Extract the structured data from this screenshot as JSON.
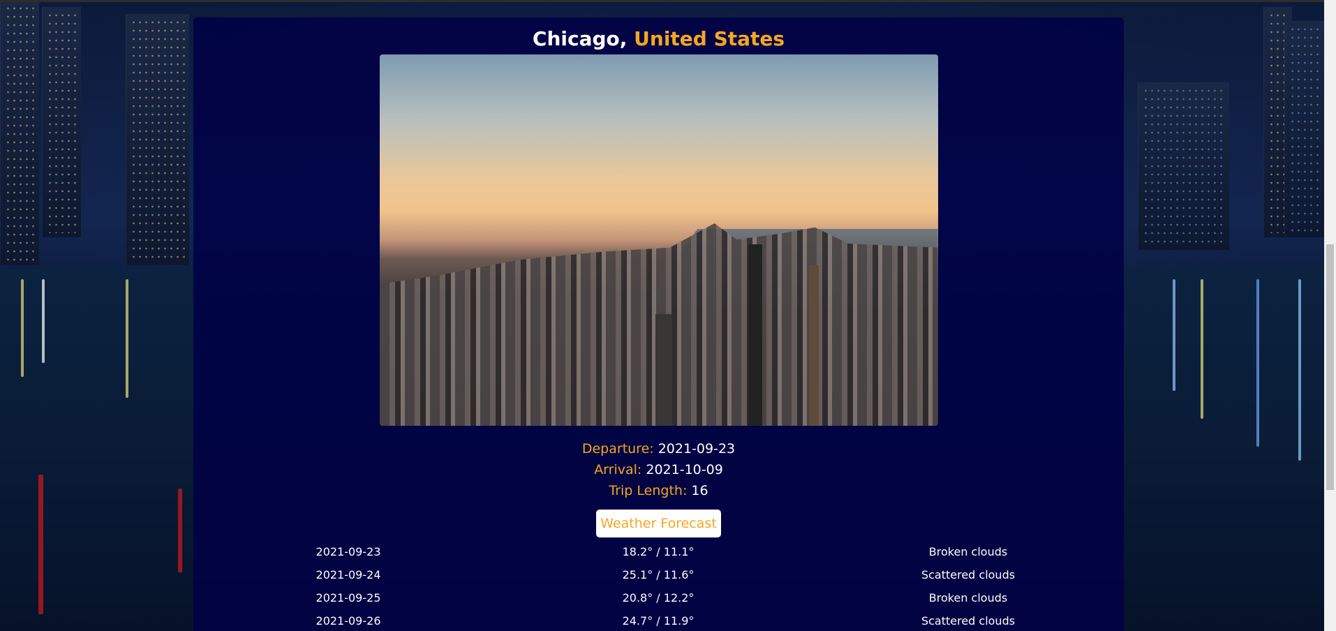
{
  "trip": {
    "city": "Chicago,",
    "country": "United States"
  },
  "details": {
    "departure_label": "Departure:",
    "departure_value": "2021-09-23",
    "arrival_label": "Arrival:",
    "arrival_value": "2021-10-09",
    "length_label": "Trip Length:",
    "length_value": "16"
  },
  "forecast_button_label": "Weather Forecast",
  "forecast": [
    {
      "date": "2021-09-23",
      "temps": "18.2° / 11.1°",
      "desc": "Broken clouds"
    },
    {
      "date": "2021-09-24",
      "temps": "25.1° / 11.6°",
      "desc": "Scattered clouds"
    },
    {
      "date": "2021-09-25",
      "temps": "20.8° / 12.2°",
      "desc": "Broken clouds"
    },
    {
      "date": "2021-09-26",
      "temps": "24.7° / 11.9°",
      "desc": "Scattered clouds"
    }
  ],
  "colors": {
    "accent": "#f5a623",
    "card_bg": "#000046",
    "text": "#ffffff"
  }
}
